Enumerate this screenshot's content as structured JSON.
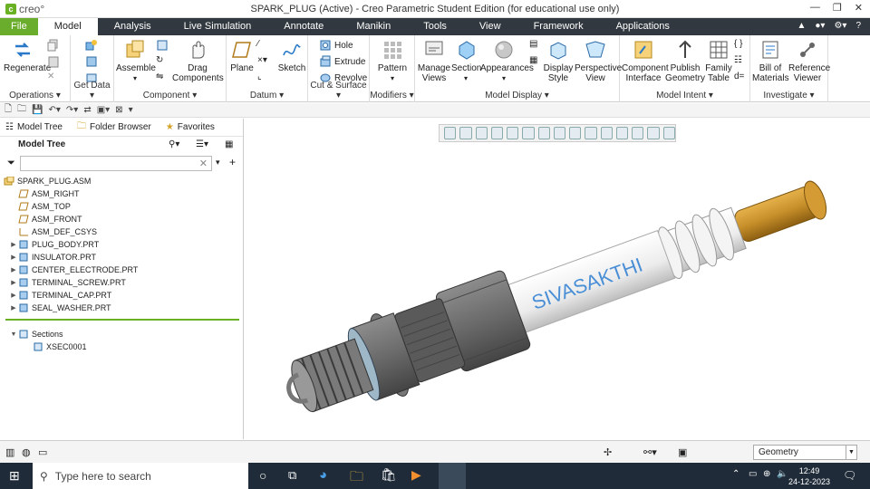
{
  "app": {
    "logo_text": "creo°",
    "title": "SPARK_PLUG (Active) - Creo Parametric Student Edition (for educational use only)"
  },
  "menu": {
    "file": "File",
    "tabs": [
      "Model",
      "Analysis",
      "Live Simulation",
      "Annotate",
      "Manikin",
      "Tools",
      "View",
      "Framework",
      "Applications"
    ],
    "active": "Model"
  },
  "ribbon": {
    "operations": {
      "label": "Operations",
      "regenerate": "Regenerate"
    },
    "getdata": {
      "label": "Get Data"
    },
    "component": {
      "label": "Component",
      "assemble": "Assemble",
      "drag": "Drag Components"
    },
    "datum": {
      "label": "Datum",
      "plane": "Plane",
      "sketch": "Sketch"
    },
    "cutsurface": {
      "label": "Cut & Surface",
      "hole": "Hole",
      "extrude": "Extrude",
      "revolve": "Revolve"
    },
    "modifiers": {
      "label": "Modifiers",
      "pattern": "Pattern"
    },
    "modeldisplay": {
      "label": "Model Display",
      "manage_views": "Manage Views",
      "section": "Section",
      "appearances": "Appearances",
      "display_style": "Display Style",
      "perspective": "Perspective View"
    },
    "modelintent": {
      "label": "Model Intent",
      "component_interface": "Component Interface",
      "publish_geometry": "Publish Geometry",
      "family_table": "Family Table",
      "d_eq": "d="
    },
    "investigate": {
      "label": "Investigate",
      "bom": "Bill of Materials",
      "reference_viewer": "Reference Viewer"
    }
  },
  "nav": {
    "model_tree_tab": "Model Tree",
    "folder_browser_tab": "Folder Browser",
    "favorites_tab": "Favorites",
    "tree_title": "Model Tree",
    "filter_value": ""
  },
  "tree": {
    "root": "SPARK_PLUG.ASM",
    "datums": [
      "ASM_RIGHT",
      "ASM_TOP",
      "ASM_FRONT",
      "ASM_DEF_CSYS"
    ],
    "parts": [
      "PLUG_BODY.PRT",
      "INSULATOR.PRT",
      "CENTER_ELECTRODE.PRT",
      "TERMINAL_SCREW.PRT",
      "TERMINAL_CAP.PRT",
      "SEAL_WASHER.PRT"
    ],
    "sections_label": "Sections",
    "section_item": "XSEC0001"
  },
  "model": {
    "insulator_text": "SIVASAKTHI",
    "colors": {
      "insulator": "#f2f2f2",
      "metal": "#6f6f6f",
      "cap": "#c8902a",
      "text": "#4a8fd6"
    }
  },
  "status": {
    "filter_value": "Geometry"
  },
  "taskbar": {
    "search_placeholder": "Type here to search",
    "time": "12:49",
    "date": "24-12-2023"
  }
}
